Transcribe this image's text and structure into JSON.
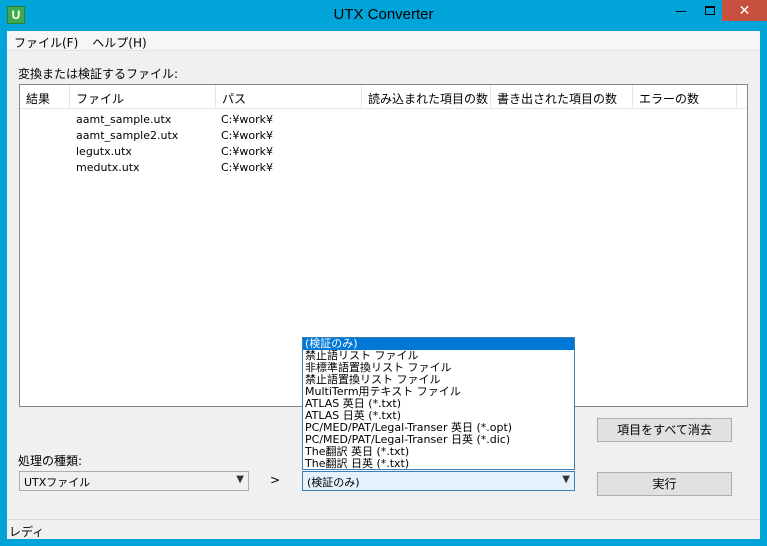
{
  "window": {
    "title": "UTX Converter",
    "icon_letter": "U",
    "close_glyph": "✕",
    "min_glyph": "—"
  },
  "menu": [
    "ファイル(F)",
    "ヘルプ(H)"
  ],
  "files_label": "変換または検証するファイル:",
  "table": {
    "columns": [
      "結果",
      "ファイル",
      "パス",
      "読み込まれた項目の数",
      "書き出された項目の数",
      "エラーの数"
    ],
    "rows": [
      {
        "result": "",
        "file": "aamt_sample.utx",
        "path": "C:¥work¥"
      },
      {
        "result": "",
        "file": "aamt_sample2.utx",
        "path": "C:¥work¥"
      },
      {
        "result": "",
        "file": "legutx.utx",
        "path": "C:¥work¥"
      },
      {
        "result": "",
        "file": "medutx.utx",
        "path": "C:¥work¥"
      }
    ]
  },
  "kind_label": "処理の種類:",
  "type_combo": {
    "value": "UTXファイル"
  },
  "arrow_glyph": ">",
  "mode_combo": {
    "value": "(検証のみ)"
  },
  "dropdown_options": [
    "(検証のみ)",
    "禁止語リスト ファイル",
    "非標準語置換リスト ファイル",
    "禁止語置換リスト ファイル",
    "MultiTerm用テキスト ファイル",
    "ATLAS 英日 (*.txt)",
    "ATLAS 日英 (*.txt)",
    "PC/MED/PAT/Legal-Transer 英日 (*.opt)",
    "PC/MED/PAT/Legal-Transer 日英 (*.dic)",
    "The翻訳 英日 (*.txt)",
    "The翻訳 日英 (*.txt)"
  ],
  "buttons": {
    "clear_all": "項目をすべて消去",
    "run": "実行"
  },
  "status": "レディ"
}
